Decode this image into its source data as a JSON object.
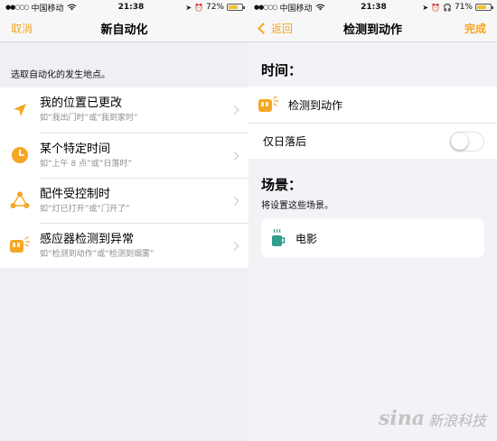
{
  "left": {
    "status": {
      "carrier": "中国移动",
      "time": "21:38",
      "battery": "72%",
      "battery_level": 0.72
    },
    "nav": {
      "cancel": "取消",
      "title": "新自动化"
    },
    "section_label": "选取自动化的发生地点。",
    "items": [
      {
        "title": "我的位置已更改",
        "subtitle": "如“我出门时”或“我到家时”",
        "icon": "location-arrow-icon"
      },
      {
        "title": "某个特定时间",
        "subtitle": "如“上午 8 点”或“日落时”",
        "icon": "clock-icon"
      },
      {
        "title": "配件受控制时",
        "subtitle": "如“灯已打开”或“门开了”",
        "icon": "accessory-network-icon"
      },
      {
        "title": "感应器检测到异常",
        "subtitle": "如“检测到动作”或“检测到烟雾”",
        "icon": "sensor-icon"
      }
    ]
  },
  "right": {
    "status": {
      "carrier": "中国移动",
      "time": "21:38",
      "battery": "71%",
      "battery_level": 0.71
    },
    "nav": {
      "back": "返回",
      "title": "检测到动作",
      "done": "完成"
    },
    "time_header": "时间：",
    "time_rows": [
      {
        "label": "检测到动作",
        "icon": "sensor-icon"
      },
      {
        "label": "仅日落后",
        "toggle": false
      }
    ],
    "scene_header": "场景：",
    "scene_sub": "将设置这些场景。",
    "scene": {
      "label": "电影",
      "icon": "coffee-cup-icon"
    }
  },
  "watermark": {
    "logo": "sina",
    "text": "新浪科技"
  },
  "colors": {
    "accent": "#f5a623",
    "background": "#efeff4"
  }
}
